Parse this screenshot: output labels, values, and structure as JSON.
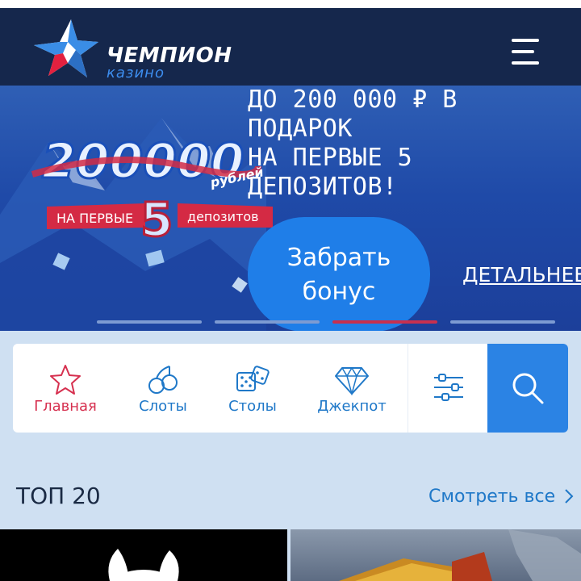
{
  "header": {
    "logo_title": "ЧЕМПИОН",
    "logo_subtitle": "казино",
    "colors": {
      "background": "#15274c",
      "accent": "#3d8ef0",
      "star_red": "#e3213f"
    }
  },
  "banner": {
    "headline_lines": [
      "ДО 200 000 ₽ В",
      "ПОДАРОК",
      "НА ПЕРВЫЕ 5",
      "ДЕПОЗИТОВ!"
    ],
    "art": {
      "amount": "200000",
      "currency_word": "рублей",
      "ribbon_left": "НА ПЕРВЫЕ",
      "ribbon_number": "5",
      "ribbon_right": "депозитов"
    },
    "cta_lines": [
      "Забрать",
      "бонус"
    ],
    "details_link": "ДЕТАЛЬНЕЕ",
    "slides": {
      "count": 4,
      "active_index": 2
    }
  },
  "nav": {
    "items": [
      {
        "label": "Главная",
        "icon": "star-icon",
        "active": true
      },
      {
        "label": "Слоты",
        "icon": "cherries-icon",
        "active": false
      },
      {
        "label": "Столы",
        "icon": "dice-icon",
        "active": false
      },
      {
        "label": "Джекпот",
        "icon": "diamond-icon",
        "active": false
      }
    ],
    "filter_icon": "sliders-icon",
    "search_icon": "search-icon"
  },
  "top_section": {
    "title": "ТОП 20",
    "see_all": "Смотреть все",
    "see_all_icon": "chevron-right-icon"
  },
  "games": [
    {
      "icon": "bunny-logo-icon",
      "background": "#000000"
    },
    {
      "icon": "winged-emblem-icon",
      "background": "#6f7f95"
    }
  ]
}
